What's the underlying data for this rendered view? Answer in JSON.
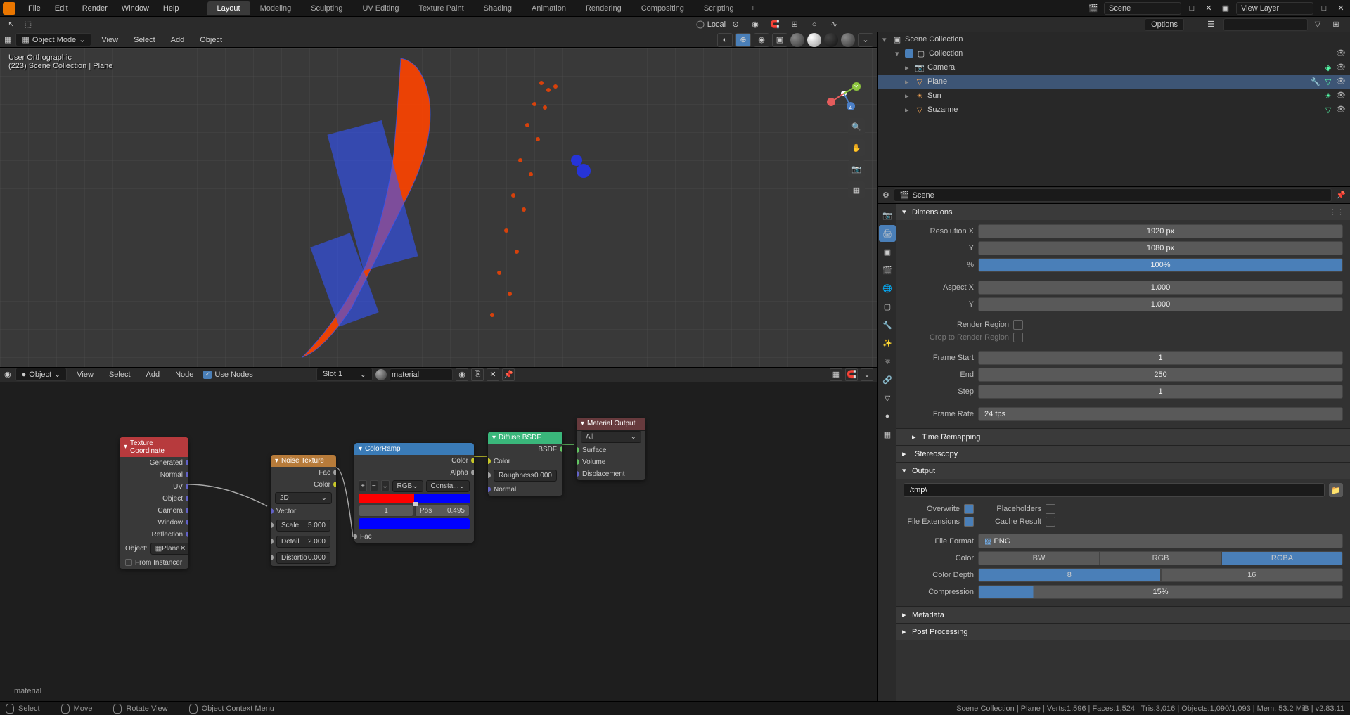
{
  "top_menu": {
    "items": [
      "File",
      "Edit",
      "Render",
      "Window",
      "Help"
    ],
    "workspaces": [
      "Layout",
      "Modeling",
      "Sculpting",
      "UV Editing",
      "Texture Paint",
      "Shading",
      "Animation",
      "Rendering",
      "Compositing",
      "Scripting"
    ],
    "active_workspace": "Layout",
    "scene_label": "Scene",
    "view_layer_label": "View Layer"
  },
  "toolbar2": {
    "local_label": "Local",
    "options_label": "Options"
  },
  "viewport": {
    "mode": "Object Mode",
    "header_menus": [
      "View",
      "Select",
      "Add",
      "Object"
    ],
    "info_line1": "User Orthographic",
    "info_line2": "(223) Scene Collection | Plane"
  },
  "outliner": {
    "root": "Scene Collection",
    "collection": "Collection",
    "items": [
      {
        "name": "Camera",
        "type": "camera"
      },
      {
        "name": "Plane",
        "type": "mesh",
        "selected": true
      },
      {
        "name": "Sun",
        "type": "light"
      },
      {
        "name": "Suzanne",
        "type": "mesh"
      }
    ]
  },
  "node_editor": {
    "type_label": "Object",
    "menus": [
      "View",
      "Select",
      "Add",
      "Node"
    ],
    "use_nodes_label": "Use Nodes",
    "slot_label": "Slot 1",
    "material_name": "material",
    "mat_label": "material",
    "nodes": {
      "tex_coord": {
        "title": "Texture Coordinate",
        "outputs": [
          "Generated",
          "Normal",
          "UV",
          "Object",
          "Camera",
          "Window",
          "Reflection"
        ],
        "object_label": "Object:",
        "object_value": "Plane",
        "from_instancer": "From Instancer"
      },
      "noise": {
        "title": "Noise Texture",
        "fac_label": "Fac",
        "color_label": "Color",
        "dim_value": "2D",
        "vector_label": "Vector",
        "scale_label": "Scale",
        "scale_value": "5.000",
        "detail_label": "Detail",
        "detail_value": "2.000",
        "distortion_label": "Distortio",
        "distortion_value": "0.000"
      },
      "color_ramp": {
        "title": "ColorRamp",
        "color_out": "Color",
        "alpha_out": "Alpha",
        "mode_rgb": "RGB",
        "interp": "Consta...",
        "pos_value": "1",
        "pos_label": "Pos",
        "pos_num": "0.495",
        "fac_label": "Fac"
      },
      "diffuse": {
        "title": "Diffuse BSDF",
        "bsdf_out": "BSDF",
        "color_in": "Color",
        "roughness_label": "Roughness",
        "roughness_value": "0.000",
        "normal_in": "Normal"
      },
      "output": {
        "title": "Material Output",
        "target": "All",
        "surface": "Surface",
        "volume": "Volume",
        "displacement": "Displacement"
      }
    }
  },
  "properties": {
    "scene_label": "Scene",
    "dimensions": {
      "title": "Dimensions",
      "res_x_label": "Resolution X",
      "res_x": "1920 px",
      "y_label": "Y",
      "res_y": "1080 px",
      "pct_label": "%",
      "pct": "100%",
      "aspect_x_label": "Aspect X",
      "aspect_x": "1.000",
      "aspect_y": "1.000",
      "render_region_label": "Render Region",
      "crop_label": "Crop to Render Region",
      "frame_start_label": "Frame Start",
      "frame_start": "1",
      "end_label": "End",
      "end": "250",
      "step_label": "Step",
      "step": "1",
      "frame_rate_label": "Frame Rate",
      "frame_rate": "24 fps"
    },
    "time_remapping": "Time Remapping",
    "stereoscopy": "Stereoscopy",
    "output": {
      "title": "Output",
      "path": "/tmp\\",
      "overwrite_label": "Overwrite",
      "placeholders_label": "Placeholders",
      "file_ext_label": "File Extensions",
      "cache_label": "Cache Result",
      "format_label": "File Format",
      "format": "PNG",
      "color_label": "Color",
      "bw": "BW",
      "rgb": "RGB",
      "rgba": "RGBA",
      "depth_label": "Color Depth",
      "d8": "8",
      "d16": "16",
      "compression_label": "Compression",
      "compression": "15%"
    },
    "metadata": "Metadata",
    "post_processing": "Post Processing"
  },
  "status_bar": {
    "select": "Select",
    "move": "Move",
    "rotate": "Rotate View",
    "context": "Object Context Menu",
    "stats": "Scene Collection | Plane | Verts:1,596 | Faces:1,524 | Tris:3,016 | Objects:1,090/1,093 | Mem: 53.2 MiB | v2.83.11"
  }
}
